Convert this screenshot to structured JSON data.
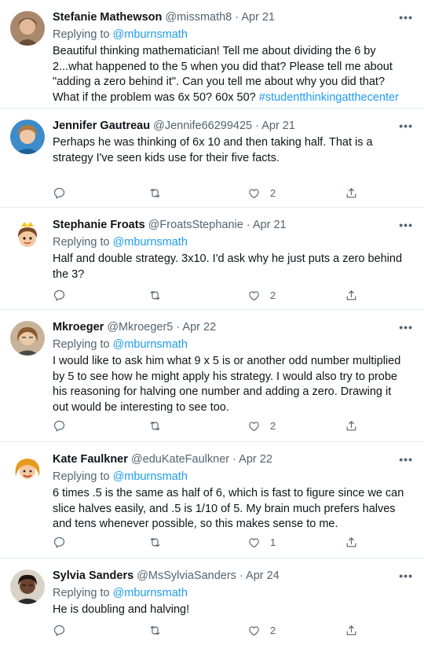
{
  "tweets": [
    {
      "name": "Stefanie Mathewson",
      "handle": "@missmath8",
      "date": "· Apr 21",
      "replying_prefix": "Replying to ",
      "replying_to": "@mburnsmath",
      "text": "Beautiful thinking mathematician!  Tell me about dividing the 6 by 2...what happened to the 5 when you did that?  Please tell me about \"adding a zero behind it\".  Can you tell me about why you did that?  What if the problem was 6x 50?  60x 50? ",
      "hashtag": "#studentthinkingatthecenter",
      "like_count": ""
    },
    {
      "name": "Jennifer Gautreau",
      "handle": "@Jennife66299425",
      "date": "· Apr 21",
      "replying_prefix": "",
      "replying_to": "",
      "text": "Perhaps he was thinking of 6x 10 and then taking half. That is a strategy I've seen kids use for their five facts.",
      "hashtag": "",
      "like_count": "2"
    },
    {
      "name": "Stephanie Froats",
      "handle": "@FroatsStephanie",
      "date": "· Apr 21",
      "replying_prefix": "Replying to ",
      "replying_to": "@mburnsmath",
      "text": "Half and double strategy. 3x10. I'd ask why he just puts a zero behind the 3?",
      "hashtag": "",
      "like_count": "2"
    },
    {
      "name": "Mkroeger",
      "handle": "@Mkroeger5",
      "date": "· Apr 22",
      "replying_prefix": "Replying to ",
      "replying_to": "@mburnsmath",
      "text": "I would like to ask him what 9 x 5 is or another odd number multiplied by 5 to see how he might apply his strategy. I would also try to probe his reasoning for halving one number and adding a zero. Drawing it out would be interesting to see too.",
      "hashtag": "",
      "like_count": "2"
    },
    {
      "name": "Kate Faulkner",
      "handle": "@eduKateFaulkner",
      "date": "· Apr 22",
      "replying_prefix": "Replying to ",
      "replying_to": "@mburnsmath",
      "text": "6 times .5 is the same as half of 6, which is fast to figure since we can slice halves easily, and .5 is 1/10 of 5. My brain much prefers halves and tens whenever possible, so this makes sense to me.",
      "hashtag": "",
      "like_count": "1"
    },
    {
      "name": "Sylvia Sanders",
      "handle": "@MsSylviaSanders",
      "date": "· Apr 24",
      "replying_prefix": "Replying to ",
      "replying_to": "@mburnsmath",
      "text": "He is doubling and halving!",
      "hashtag": "",
      "like_count": "2"
    }
  ],
  "more_label": "•••",
  "icons": {
    "reply": "reply-icon",
    "retweet": "retweet-icon",
    "like": "like-icon",
    "share": "share-icon",
    "more": "more-options-icon"
  }
}
